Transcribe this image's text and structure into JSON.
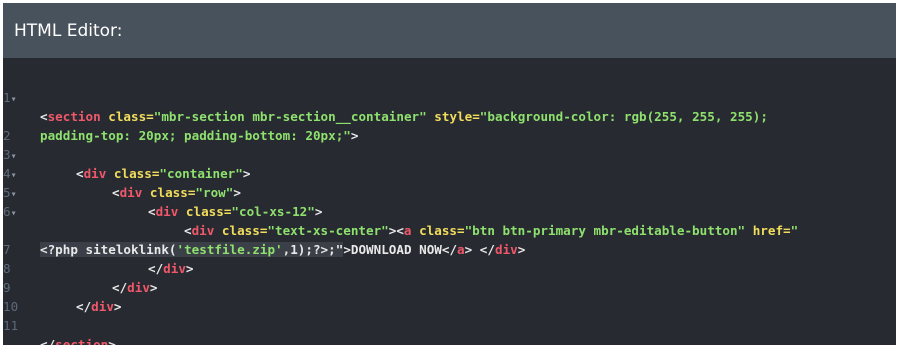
{
  "header": {
    "title": "HTML Editor:"
  },
  "gutter": [
    "1",
    "",
    "2",
    "3",
    "4",
    "5",
    "6",
    "",
    "7",
    "8",
    "9",
    "10",
    "11"
  ],
  "code": {
    "l1a_lt": "<",
    "l1a_tag": "section",
    "l1a_a1": " class=",
    "l1a_s1": "\"mbr-section mbr-section__container\"",
    "l1a_a2": " style=",
    "l1a_s2": "\"background-color: rgb(255, 255, 255);",
    "l1b_s": "padding-top: 20px; padding-bottom: 20px;\"",
    "l1b_gt": ">",
    "l3_lt": "<",
    "l3_tag": "div",
    "l3_a": " class=",
    "l3_s": "\"container\"",
    "l3_gt": ">",
    "l4_lt": "<",
    "l4_tag": "div",
    "l4_a": " class=",
    "l4_s": "\"row\"",
    "l4_gt": ">",
    "l5_lt": "<",
    "l5_tag": "div",
    "l5_a": " class=",
    "l5_s": "\"col-xs-12\"",
    "l5_gt": ">",
    "l6a_lt": "<",
    "l6a_tag": "div",
    "l6a_a1": " class=",
    "l6a_s1": "\"text-xs-center\"",
    "l6a_gt1": "><",
    "l6a_tag2": "a",
    "l6a_a2": " class=",
    "l6a_s2": "\"btn btn-primary mbr-editable-button\"",
    "l6a_a3": " href=",
    "l6a_s3": "\"",
    "l6b_php": "<?php siteloklink(",
    "l6b_str": "'testfile.zip'",
    "l6b_rest": ",1);?>;\"",
    "l6b_gt": ">DOWNLOAD NOW</",
    "l6b_tag3": "a",
    "l6b_gt2": "> </",
    "l6b_tag4": "div",
    "l6b_gt3": ">",
    "l7_lt": "</",
    "l7_tag": "div",
    "l7_gt": ">",
    "l8_lt": "</",
    "l8_tag": "div",
    "l8_gt": ">",
    "l9_lt": "</",
    "l9_tag": "div",
    "l9_gt": ">",
    "l11_lt": "</",
    "l11_tag": "section",
    "l11_gt": ">"
  },
  "icons": {
    "fold_marker": "▾"
  },
  "colors": {
    "background": "#272a31",
    "header": "#48525c",
    "tag": "#f0586a",
    "attribute": "#f1dd5c",
    "string": "#8fe16e",
    "text": "#e9e9e9",
    "line_number": "#5f6a78"
  }
}
